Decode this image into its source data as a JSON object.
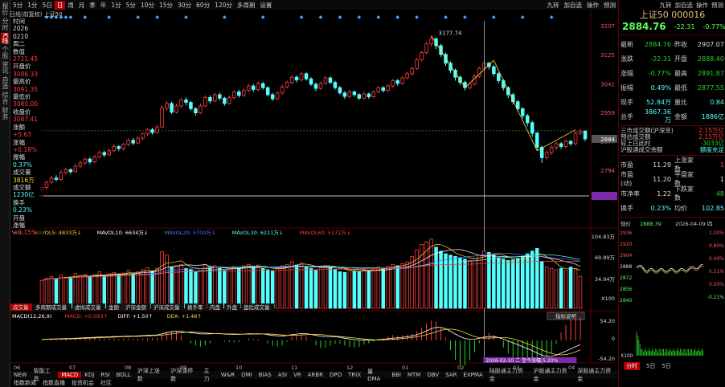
{
  "left_tabs": [
    "报价",
    "分时",
    "K线",
    "个股",
    "资讯",
    "自选",
    "综合",
    "财务"
  ],
  "left_active": 2,
  "top_tabs": [
    "5分",
    "1分",
    "5日",
    "日",
    "周",
    "月",
    "季",
    "年",
    "1分",
    "5分",
    "10分",
    "15分",
    "30分",
    "60分",
    "120分",
    "多周期",
    "设置"
  ],
  "top_active": 3,
  "top_right": [
    "九转",
    "加自选",
    "操作",
    "预测"
  ],
  "chart_title": "日线(前复权) 上证50",
  "info_panel": [
    {
      "t": "时间",
      "c": "wht"
    },
    {
      "t": "2026",
      "c": "wht"
    },
    {
      "t": "0210",
      "c": "wht"
    },
    {
      "t": "周二",
      "c": "wht"
    },
    {
      "t": "数值",
      "c": "wht"
    },
    {
      "t": "2721.45",
      "c": "red"
    },
    {
      "t": "开盘价",
      "c": "wht"
    },
    {
      "t": "3086.33",
      "c": "red"
    },
    {
      "t": "最高价",
      "c": "wht"
    },
    {
      "t": "3091.35",
      "c": "red"
    },
    {
      "t": "最低价",
      "c": "wht"
    },
    {
      "t": "3080.00",
      "c": "red"
    },
    {
      "t": "收盘价",
      "c": "wht"
    },
    {
      "t": "3087.41",
      "c": "red"
    },
    {
      "t": "涨额",
      "c": "wht"
    },
    {
      "t": "+5.63",
      "c": "red"
    },
    {
      "t": "涨幅",
      "c": "wht"
    },
    {
      "t": "+0.18%",
      "c": "red"
    },
    {
      "t": "振幅",
      "c": "wht"
    },
    {
      "t": "0.37%",
      "c": "cyan"
    },
    {
      "t": "成交量",
      "c": "wht"
    },
    {
      "t": "3816万",
      "c": "yel"
    },
    {
      "t": "成交额",
      "c": "wht"
    },
    {
      "t": "1230亿",
      "c": "cyan"
    },
    {
      "t": "换手",
      "c": "wht"
    },
    {
      "t": "0.23%",
      "c": "cyan"
    },
    {
      "t": "开盘",
      "c": "wht"
    },
    {
      "t": "涨幅",
      "c": "wht"
    },
    {
      "t": "+0.15%",
      "c": "red"
    }
  ],
  "price_ticks": [
    "3207",
    "3125",
    "3041",
    "2959",
    "2877",
    "2794",
    "2721"
  ],
  "current_price_label": "2884",
  "peak_label": "3177.74",
  "vol_legend": [
    {
      "t": "VOL:",
      "c": "#ffffff"
    },
    {
      "t": "MAVOL5: 4833万↓",
      "c": "#ffd93b"
    },
    {
      "t": "MAVOL10: 6634万↓",
      "c": "#ffffff"
    },
    {
      "t": "MAVOL20: 5700万↓",
      "c": "#4a7aff"
    },
    {
      "t": "MAVOL30: 6211万↓",
      "c": "#54ffff"
    },
    {
      "t": "MAVOL60: 5171万↓",
      "c": "#ff3b3b"
    }
  ],
  "vol_ticks": [
    "104.83万",
    "69.89万",
    "34.94万",
    "X100"
  ],
  "vol_sub_tabs": [
    "成交量",
    "多周期成交量",
    "虚拟成交量",
    "金额",
    "沪深金额",
    "沪深成交量",
    "换手率",
    "内盘",
    "外盘",
    "盘后成交量"
  ],
  "macd_legend": [
    {
      "t": "MACD(12,26,9)",
      "c": "#ffffff"
    },
    {
      "t": "MACD: +0.093↑",
      "c": "#ff3b3b"
    },
    {
      "t": "DIFF: +1.50↑",
      "c": "#ffffff"
    },
    {
      "t": "DEA: +1.46↑",
      "c": "#ffd93b"
    }
  ],
  "macd_ticks": [
    "54.20",
    "0",
    "-54.20"
  ],
  "indicator_button": "指标说明",
  "crosshair_date": "2026-02-10 二 至今涨幅:5.20%",
  "month_ticks": [
    "06",
    "07",
    "08",
    "09",
    "10",
    "11",
    "12",
    "01",
    "02",
    "03",
    "04"
  ],
  "indicator_tabs": [
    "NEW",
    "智能工具",
    "MACD",
    "KDJ",
    "RSI",
    "BOLL",
    "沪深上涨数",
    "沪深涨停数",
    "主力",
    "W&R",
    "DMI",
    "BIAS",
    "ASI",
    "VR",
    "ARBR",
    "DPO",
    "TRIX",
    "量DMA",
    "BBI",
    "MTM",
    "OBV",
    "SAR",
    "EXPMA",
    "陆股通主力资金",
    "沪股通主力资金",
    "深股通主力资金"
  ],
  "indicator_active": "MACD",
  "bottom_links": [
    "指数新闻",
    "指数直播",
    "投资机会",
    "社区"
  ],
  "rp": {
    "header": [
      "九转",
      "加自选",
      "操作",
      "预测"
    ],
    "name": "上证50 000016",
    "price": "2884.76",
    "chg": "-22.31",
    "pct": "-0.77%",
    "rows": [
      {
        "k": "最新",
        "v": "2884.76",
        "vc": "green",
        "k2": "昨收",
        "v2": "2907.07",
        "v2c": "wht"
      },
      {
        "k": "涨跌",
        "v": "-22.31",
        "vc": "green",
        "k2": "开盘",
        "v2": "2888.40",
        "v2c": "green"
      },
      {
        "k": "涨幅",
        "v": "-0.77%",
        "vc": "green",
        "k2": "最高",
        "v2": "2891.87",
        "v2c": "green"
      },
      {
        "k": "振幅",
        "v": "0.49%",
        "vc": "cyan",
        "k2": "最低",
        "v2": "2877.55",
        "v2c": "green"
      },
      {
        "k": "现手",
        "v": "52.84万",
        "vc": "cyan",
        "k2": "量比",
        "v2": "0.84",
        "v2c": "cyan"
      },
      {
        "k": "总手",
        "v": "3867.36万",
        "vc": "cyan",
        "k2": "金额",
        "v2": "1886亿",
        "v2c": "cyan"
      }
    ],
    "extra": [
      {
        "k": "三市成交额(沪深京)",
        "v": "2.15万亿"
      },
      {
        "k": "预估成交额",
        "v": "2.15万亿"
      },
      {
        "k": "较上日此时",
        "v": "-3033亿"
      },
      {
        "k": "沪股通成交余额",
        "v": "额度充足"
      }
    ],
    "rows2": [
      {
        "k": "市盈",
        "v": "11.29",
        "vc": "wht",
        "k2": "上涨家数",
        "v2": "1",
        "v2c": "red"
      },
      {
        "k": "市盈(动)",
        "v": "11.20",
        "vc": "wht",
        "k2": "平盘家数",
        "v2": "1",
        "v2c": "wht"
      },
      {
        "k": "市净率",
        "v": "1.22",
        "vc": "wht",
        "k2": "下跌家数",
        "v2": "48",
        "v2c": "green"
      },
      {
        "k": "换手",
        "v": "0.23%",
        "vc": "cyan",
        "k2": "均价",
        "v2": "102.85",
        "v2c": "cyan"
      }
    ],
    "mini_header": {
      "a": "现价",
      "b": "2888.39",
      "c": "2026-04-09 四"
    },
    "mini_left": [
      "2936",
      "2920",
      "2904",
      "2888",
      "2872",
      "2856",
      "2840"
    ],
    "mini_right": [
      "1.00%",
      "0.80%",
      "0.40%",
      "0.21%",
      "0.00%",
      "-0.21%"
    ],
    "mini_vol": "X100",
    "bottom_tabs": [
      "分时",
      "5日",
      "5日"
    ],
    "bottom_active": 0
  },
  "chart_data": {
    "type": "candlestick",
    "ylim": [
      2721,
      3207
    ],
    "candles": [
      [
        2738,
        2745,
        2730,
        2750
      ],
      [
        2745,
        2760,
        2740,
        2765
      ],
      [
        2760,
        2772,
        2755,
        2778
      ],
      [
        2772,
        2768,
        2762,
        2780
      ],
      [
        2768,
        2788,
        2765,
        2795
      ],
      [
        2788,
        2796,
        2782,
        2802
      ],
      [
        2796,
        2790,
        2784,
        2800
      ],
      [
        2790,
        2806,
        2788,
        2812
      ],
      [
        2806,
        2815,
        2800,
        2822
      ],
      [
        2815,
        2826,
        2810,
        2830
      ],
      [
        2826,
        2818,
        2812,
        2832
      ],
      [
        2818,
        2832,
        2815,
        2838
      ],
      [
        2832,
        2845,
        2828,
        2850
      ],
      [
        2845,
        2838,
        2832,
        2850
      ],
      [
        2838,
        2850,
        2835,
        2856
      ],
      [
        2850,
        2862,
        2846,
        2868
      ],
      [
        2862,
        2856,
        2850,
        2866
      ],
      [
        2856,
        2868,
        2850,
        2872
      ],
      [
        2868,
        2880,
        2862,
        2885
      ],
      [
        2880,
        2872,
        2866,
        2886
      ],
      [
        2872,
        2886,
        2868,
        2892
      ],
      [
        2886,
        2898,
        2880,
        2902
      ],
      [
        2898,
        2910,
        2892,
        2915
      ],
      [
        2910,
        2902,
        2896,
        2916
      ],
      [
        2902,
        2918,
        2898,
        2924
      ],
      [
        2918,
        2972,
        2915,
        2980
      ],
      [
        2972,
        2985,
        2965,
        2992
      ],
      [
        2985,
        2960,
        2955,
        2990
      ],
      [
        2960,
        2978,
        2956,
        2984
      ],
      [
        2978,
        2995,
        2972,
        3000
      ],
      [
        2995,
        2988,
        2980,
        3002
      ],
      [
        2988,
        2970,
        2965,
        2992
      ],
      [
        2970,
        2958,
        2950,
        2975
      ],
      [
        2958,
        2978,
        2955,
        2984
      ],
      [
        2978,
        3002,
        2975,
        3008
      ],
      [
        3002,
        2992,
        2985,
        3008
      ],
      [
        2992,
        3010,
        2988,
        3015
      ],
      [
        3010,
        3000,
        2994,
        3016
      ],
      [
        3000,
        2985,
        2978,
        3004
      ],
      [
        2985,
        3002,
        2982,
        3008
      ],
      [
        3002,
        3018,
        2998,
        3022
      ],
      [
        3018,
        3008,
        3002,
        3024
      ],
      [
        3008,
        3022,
        3004,
        3028
      ],
      [
        3022,
        3035,
        3018,
        3040
      ],
      [
        3035,
        3025,
        3018,
        3040
      ],
      [
        3025,
        3042,
        3020,
        3048
      ],
      [
        3042,
        3030,
        3025,
        3046
      ],
      [
        3030,
        3010,
        3005,
        3034
      ],
      [
        3010,
        2998,
        2992,
        3015
      ],
      [
        2998,
        3015,
        2995,
        3020
      ],
      [
        3015,
        3032,
        3010,
        3038
      ],
      [
        3032,
        3045,
        3028,
        3050
      ],
      [
        3045,
        3060,
        3040,
        3065
      ],
      [
        3060,
        3052,
        3045,
        3065
      ],
      [
        3052,
        3070,
        3048,
        3075
      ],
      [
        3070,
        3055,
        3050,
        3074
      ],
      [
        3055,
        3040,
        3035,
        3060
      ],
      [
        3040,
        3028,
        3020,
        3045
      ],
      [
        3028,
        3042,
        3024,
        3048
      ],
      [
        3042,
        3058,
        3038,
        3062
      ],
      [
        3058,
        3045,
        3040,
        3062
      ],
      [
        3045,
        3030,
        3025,
        3050
      ],
      [
        3030,
        3015,
        3010,
        3035
      ],
      [
        3015,
        3005,
        2998,
        3020
      ],
      [
        3005,
        3018,
        3000,
        3024
      ],
      [
        3018,
        3010,
        3004,
        3022
      ],
      [
        3010,
        3000,
        2995,
        3014
      ],
      [
        3000,
        3012,
        2996,
        3018
      ],
      [
        3012,
        3004,
        2998,
        3016
      ],
      [
        3004,
        3018,
        3000,
        3022
      ],
      [
        3018,
        3030,
        3014,
        3035
      ],
      [
        3030,
        3022,
        3016,
        3034
      ],
      [
        3022,
        3035,
        3018,
        3040
      ],
      [
        3035,
        3050,
        3030,
        3055
      ],
      [
        3050,
        3042,
        3036,
        3055
      ],
      [
        3042,
        3058,
        3038,
        3062
      ],
      [
        3058,
        3070,
        3054,
        3075
      ],
      [
        3070,
        3085,
        3065,
        3090
      ],
      [
        3085,
        3110,
        3080,
        3115
      ],
      [
        3110,
        3130,
        3105,
        3135
      ],
      [
        3130,
        3155,
        3125,
        3160
      ],
      [
        3155,
        3170,
        3148,
        3178
      ],
      [
        3170,
        3150,
        3140,
        3172
      ],
      [
        3150,
        3125,
        3118,
        3155
      ],
      [
        3125,
        3100,
        3092,
        3130
      ],
      [
        3100,
        3080,
        3072,
        3105
      ],
      [
        3080,
        3060,
        3050,
        3085
      ],
      [
        3060,
        3045,
        3038,
        3065
      ],
      [
        3045,
        3030,
        3022,
        3050
      ],
      [
        3030,
        3040,
        3025,
        3046
      ],
      [
        3040,
        3062,
        3036,
        3068
      ],
      [
        3062,
        3085,
        3058,
        3090
      ],
      [
        3085,
        3100,
        3080,
        3108
      ],
      [
        3100,
        3090,
        3082,
        3104
      ],
      [
        3090,
        3070,
        3062,
        3094
      ],
      [
        3070,
        3050,
        3042,
        3074
      ],
      [
        3050,
        3030,
        3022,
        3055
      ],
      [
        3030,
        3010,
        3000,
        3035
      ],
      [
        3010,
        2990,
        2982,
        3015
      ],
      [
        2990,
        2970,
        2962,
        2995
      ],
      [
        2970,
        2950,
        2942,
        2975
      ],
      [
        2950,
        2930,
        2920,
        2955
      ],
      [
        2930,
        2900,
        2890,
        2935
      ],
      [
        2900,
        2860,
        2850,
        2905
      ],
      [
        2860,
        2830,
        2815,
        2865
      ],
      [
        2830,
        2845,
        2825,
        2850
      ],
      [
        2845,
        2860,
        2838,
        2866
      ],
      [
        2860,
        2870,
        2852,
        2876
      ],
      [
        2870,
        2862,
        2855,
        2875
      ],
      [
        2862,
        2877,
        2858,
        2882
      ],
      [
        2877,
        2870,
        2864,
        2880
      ],
      [
        2870,
        2900,
        2866,
        2906
      ],
      [
        2900,
        2906,
        2895,
        2912
      ],
      [
        2906,
        2884,
        2877,
        2908
      ]
    ],
    "volume": [
      42,
      45,
      48,
      44,
      50,
      46,
      47,
      52,
      49,
      51,
      47,
      50,
      55,
      48,
      52,
      54,
      50,
      53,
      57,
      52,
      55,
      58,
      61,
      56,
      60,
      85,
      80,
      62,
      64,
      66,
      60,
      58,
      55,
      60,
      66,
      62,
      64,
      60,
      57,
      60,
      63,
      61,
      64,
      66,
      62,
      65,
      60,
      58,
      56,
      60,
      64,
      66,
      70,
      65,
      68,
      63,
      60,
      58,
      61,
      64,
      62,
      58,
      55,
      54,
      58,
      56,
      55,
      57,
      56,
      59,
      62,
      60,
      63,
      66,
      64,
      67,
      70,
      78,
      88,
      96,
      100,
      104,
      92,
      86,
      82,
      80,
      78,
      76,
      74,
      72,
      75,
      80,
      86,
      84,
      80,
      76,
      74,
      72,
      73,
      75,
      78,
      82,
      86,
      90,
      70,
      62,
      60,
      58,
      60,
      57,
      62,
      60,
      48
    ],
    "macd": [
      2,
      3,
      4,
      3,
      4,
      5,
      4,
      5,
      6,
      7,
      6,
      7,
      8,
      7,
      8,
      9,
      8,
      9,
      10,
      9,
      10,
      11,
      12,
      11,
      12,
      20,
      22,
      18,
      17,
      18,
      16,
      14,
      12,
      13,
      15,
      14,
      15,
      13,
      11,
      12,
      14,
      13,
      14,
      15,
      13,
      14,
      12,
      9,
      7,
      9,
      11,
      13,
      15,
      14,
      15,
      12,
      9,
      6,
      7,
      9,
      8,
      6,
      3,
      1,
      2,
      1,
      0,
      1,
      0,
      2,
      4,
      3,
      5,
      7,
      6,
      8,
      10,
      13,
      17,
      22,
      27,
      31,
      28,
      22,
      16,
      10,
      5,
      1,
      0,
      3,
      6,
      9,
      10,
      8,
      5,
      1,
      -3,
      -7,
      -11,
      -15,
      -19,
      -23,
      -28,
      -34,
      -38,
      -33,
      -28,
      -24,
      -20,
      -16,
      -10,
      -6,
      -3
    ]
  }
}
